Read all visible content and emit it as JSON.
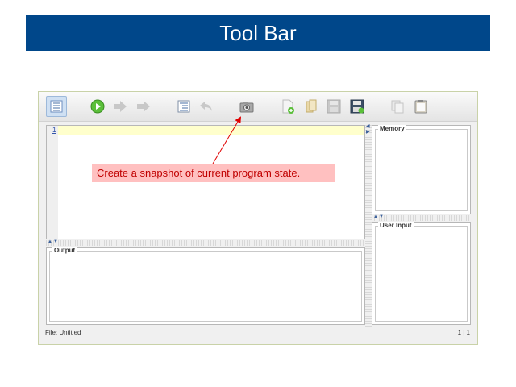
{
  "slide": {
    "title": "Tool Bar"
  },
  "toolbar": {
    "buttons": [
      {
        "icon": "list-view-icon",
        "active": true
      },
      {
        "icon": "run-icon"
      },
      {
        "icon": "step-forward-icon"
      },
      {
        "icon": "fast-forward-icon"
      },
      {
        "icon": "format-code-icon"
      },
      {
        "icon": "undo-icon"
      },
      {
        "icon": "camera-snapshot-icon"
      },
      {
        "icon": "new-file-icon"
      },
      {
        "icon": "open-file-icon"
      },
      {
        "icon": "save-icon"
      },
      {
        "icon": "save-as-icon"
      },
      {
        "icon": "copy-icon"
      },
      {
        "icon": "paste-icon"
      }
    ]
  },
  "editor": {
    "line_number": "1"
  },
  "panels": {
    "memory": "Memory",
    "user_input": "User Input",
    "output": "Output"
  },
  "status": {
    "file": "File: Untitled",
    "position": "1 | 1"
  },
  "annotation": {
    "text": "Create a snapshot of current program state."
  },
  "colors": {
    "title_bg": "#00478a",
    "callout_bg": "#ffc0c0",
    "callout_text": "#c00000",
    "arrow": "#e00000"
  }
}
